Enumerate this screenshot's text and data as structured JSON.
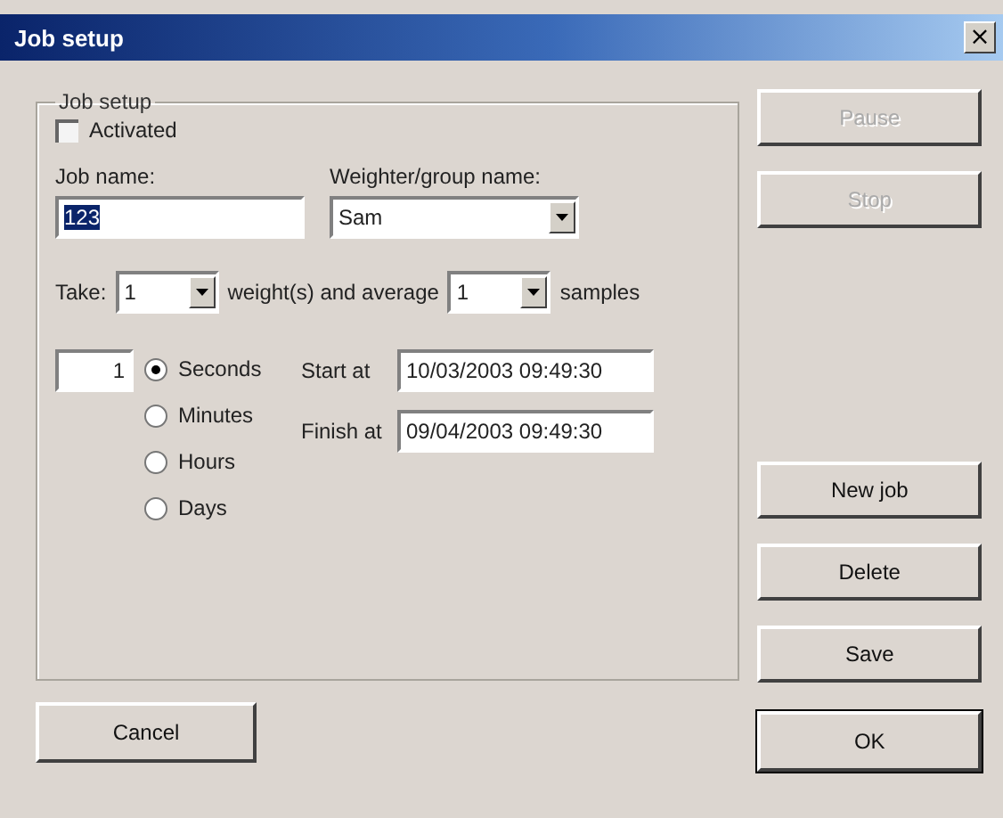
{
  "window": {
    "title": "Job setup",
    "close": "×"
  },
  "group": {
    "title": "Job setup",
    "activated": {
      "label": "Activated",
      "checked": false
    },
    "job_name": {
      "label": "Job name:",
      "value": "123",
      "selected_text": true
    },
    "weigher": {
      "label": "Weighter/group name:",
      "value": "Sam"
    },
    "take": {
      "label": "Take:",
      "value": "1"
    },
    "average_label": "weight(s) and average",
    "average": {
      "value": "1"
    },
    "samples_label": "samples",
    "interval": {
      "value": "1"
    },
    "units": [
      {
        "label": "Seconds",
        "selected": true
      },
      {
        "label": "Minutes",
        "selected": false
      },
      {
        "label": "Hours",
        "selected": false
      },
      {
        "label": "Days",
        "selected": false
      }
    ],
    "start": {
      "label": "Start at",
      "value": "10/03/2003 09:49:30"
    },
    "finish": {
      "label": "Finish at",
      "value": "09/04/2003 09:49:30"
    }
  },
  "side_buttons": [
    {
      "label": "Pause",
      "disabled": true
    },
    {
      "label": "Stop",
      "disabled": true
    }
  ],
  "action_buttons": [
    {
      "label": "New job",
      "disabled": false
    },
    {
      "label": "Delete",
      "disabled": false
    },
    {
      "label": "Save",
      "disabled": false
    }
  ],
  "cancel": {
    "label": "Cancel"
  },
  "ok": {
    "label": "OK",
    "default": true
  }
}
